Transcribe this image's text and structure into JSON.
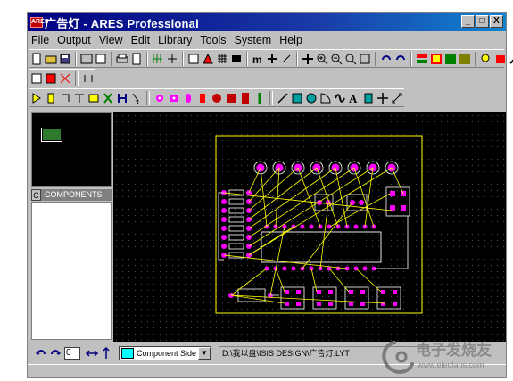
{
  "window": {
    "app_icon_text": "ARES",
    "title": "广告灯 - ARES Professional",
    "minimize": "_",
    "maximize": "□",
    "close": "X"
  },
  "menu": [
    "File",
    "Output",
    "View",
    "Edit",
    "Library",
    "Tools",
    "System",
    "Help"
  ],
  "panels": {
    "components_tab": "C",
    "components_label": "COMPONENTS"
  },
  "status": {
    "rotation_value": "0",
    "layer": "Component Side",
    "file_path": "D:\\我以盘\\ISIS DESIGN\\广告灯.LYT"
  },
  "watermark": {
    "brand_cn": "电子发烧友",
    "url": "www.elecfans.com"
  },
  "colors": {
    "canvas_bg": "#000000",
    "board_outline": "#ffff00",
    "ratsnest": "#ffff00",
    "pads": "#ff00ff",
    "silkscreen": "#ffffff",
    "traces": "#cccccc",
    "layer_swatch": "#00ffff",
    "title_bar": "#000080"
  }
}
